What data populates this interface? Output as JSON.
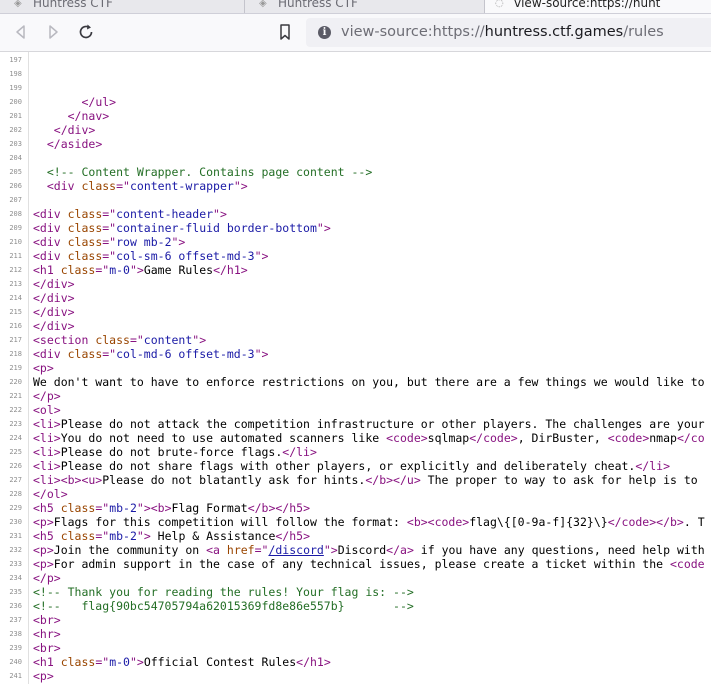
{
  "tabs": [
    {
      "title": "Huntress CTF",
      "active": false
    },
    {
      "title": "Huntress CTF",
      "active": false
    },
    {
      "title": "view-source:https://hunt",
      "active": true
    }
  ],
  "toolbar": {
    "back_icon": "arrow-left-icon",
    "forward_icon": "arrow-right-icon",
    "reload_icon": "reload-icon",
    "bookmark_icon": "bookmark-icon",
    "url_prefix": "view-source:https://",
    "url_host": "huntress.ctf.games",
    "url_path": "/rules"
  },
  "source_lines": [
    {
      "n": "197",
      "s": []
    },
    {
      "n": "198",
      "s": []
    },
    {
      "n": "199",
      "s": []
    },
    {
      "n": "200",
      "s": [
        {
          "t": "       "
        },
        {
          "c": "c-tag",
          "t": "</ul>"
        }
      ]
    },
    {
      "n": "201",
      "s": [
        {
          "t": "     "
        },
        {
          "c": "c-tag",
          "t": "</nav>"
        }
      ]
    },
    {
      "n": "202",
      "s": [
        {
          "t": "   "
        },
        {
          "c": "c-tag",
          "t": "</div>"
        }
      ]
    },
    {
      "n": "203",
      "s": [
        {
          "t": "  "
        },
        {
          "c": "c-tag",
          "t": "</aside>"
        }
      ]
    },
    {
      "n": "204",
      "s": []
    },
    {
      "n": "205",
      "s": [
        {
          "t": "  "
        },
        {
          "c": "c-cm",
          "t": "<!-- Content Wrapper. Contains page content -->"
        }
      ]
    },
    {
      "n": "206",
      "s": [
        {
          "t": "  "
        },
        {
          "c": "c-tag",
          "t": "<div "
        },
        {
          "c": "c-an",
          "t": "class"
        },
        {
          "c": "c-tag",
          "t": "=\""
        },
        {
          "c": "c-av",
          "t": "content-wrapper"
        },
        {
          "c": "c-tag",
          "t": "\">"
        }
      ]
    },
    {
      "n": "207",
      "s": []
    },
    {
      "n": "208",
      "s": [
        {
          "c": "c-tag",
          "t": "<div "
        },
        {
          "c": "c-an",
          "t": "class"
        },
        {
          "c": "c-tag",
          "t": "=\""
        },
        {
          "c": "c-av",
          "t": "content-header"
        },
        {
          "c": "c-tag",
          "t": "\">"
        }
      ]
    },
    {
      "n": "209",
      "s": [
        {
          "c": "c-tag",
          "t": "<div "
        },
        {
          "c": "c-an",
          "t": "class"
        },
        {
          "c": "c-tag",
          "t": "=\""
        },
        {
          "c": "c-av",
          "t": "container-fluid border-bottom"
        },
        {
          "c": "c-tag",
          "t": "\">"
        }
      ]
    },
    {
      "n": "210",
      "s": [
        {
          "c": "c-tag",
          "t": "<div "
        },
        {
          "c": "c-an",
          "t": "class"
        },
        {
          "c": "c-tag",
          "t": "=\""
        },
        {
          "c": "c-av",
          "t": "row mb-2"
        },
        {
          "c": "c-tag",
          "t": "\">"
        }
      ]
    },
    {
      "n": "211",
      "s": [
        {
          "c": "c-tag",
          "t": "<div "
        },
        {
          "c": "c-an",
          "t": "class"
        },
        {
          "c": "c-tag",
          "t": "=\""
        },
        {
          "c": "c-av",
          "t": "col-sm-6 offset-md-3"
        },
        {
          "c": "c-tag",
          "t": "\">"
        }
      ]
    },
    {
      "n": "212",
      "s": [
        {
          "c": "c-tag",
          "t": "<h1 "
        },
        {
          "c": "c-an",
          "t": "class"
        },
        {
          "c": "c-tag",
          "t": "=\""
        },
        {
          "c": "c-av",
          "t": "m-0"
        },
        {
          "c": "c-tag",
          "t": "\">"
        },
        {
          "t": "Game Rules"
        },
        {
          "c": "c-tag",
          "t": "</h1>"
        }
      ]
    },
    {
      "n": "213",
      "s": [
        {
          "c": "c-tag",
          "t": "</div>"
        }
      ]
    },
    {
      "n": "214",
      "s": [
        {
          "c": "c-tag",
          "t": "</div>"
        }
      ]
    },
    {
      "n": "215",
      "s": [
        {
          "c": "c-tag",
          "t": "</div>"
        }
      ]
    },
    {
      "n": "216",
      "s": [
        {
          "c": "c-tag",
          "t": "</div>"
        }
      ]
    },
    {
      "n": "217",
      "s": [
        {
          "c": "c-tag",
          "t": "<section "
        },
        {
          "c": "c-an",
          "t": "class"
        },
        {
          "c": "c-tag",
          "t": "=\""
        },
        {
          "c": "c-av",
          "t": "content"
        },
        {
          "c": "c-tag",
          "t": "\">"
        }
      ]
    },
    {
      "n": "218",
      "s": [
        {
          "c": "c-tag",
          "t": "<div "
        },
        {
          "c": "c-an",
          "t": "class"
        },
        {
          "c": "c-tag",
          "t": "=\""
        },
        {
          "c": "c-av",
          "t": "col-md-6 offset-md-3"
        },
        {
          "c": "c-tag",
          "t": "\">"
        }
      ]
    },
    {
      "n": "219",
      "s": [
        {
          "c": "c-tag",
          "t": "<p>"
        }
      ]
    },
    {
      "n": "220",
      "s": [
        {
          "t": "We don't want to have to enforce restrictions on you, but there are a few things we would like to"
        }
      ]
    },
    {
      "n": "221",
      "s": [
        {
          "c": "c-tag",
          "t": "</p>"
        }
      ]
    },
    {
      "n": "222",
      "s": [
        {
          "c": "c-tag",
          "t": "<ol>"
        }
      ]
    },
    {
      "n": "223",
      "s": [
        {
          "c": "c-tag",
          "t": "<li>"
        },
        {
          "t": "Please do not attack the competition infrastructure or other players. The challenges are your"
        }
      ]
    },
    {
      "n": "224",
      "s": [
        {
          "c": "c-tag",
          "t": "<li>"
        },
        {
          "t": "You do not need to use automated scanners like "
        },
        {
          "c": "c-tag",
          "t": "<code>"
        },
        {
          "t": "sqlmap"
        },
        {
          "c": "c-tag",
          "t": "</code>"
        },
        {
          "t": ", DirBuster, "
        },
        {
          "c": "c-tag",
          "t": "<code>"
        },
        {
          "t": "nmap"
        },
        {
          "c": "c-tag",
          "t": "</co"
        }
      ]
    },
    {
      "n": "225",
      "s": [
        {
          "c": "c-tag",
          "t": "<li>"
        },
        {
          "t": "Please do not brute-force flags."
        },
        {
          "c": "c-tag",
          "t": "</li>"
        }
      ]
    },
    {
      "n": "226",
      "s": [
        {
          "c": "c-tag",
          "t": "<li>"
        },
        {
          "t": "Please do not share flags with other players, or explicitly and deliberately cheat."
        },
        {
          "c": "c-tag",
          "t": "</li>"
        }
      ]
    },
    {
      "n": "227",
      "s": [
        {
          "c": "c-tag",
          "t": "<li><b><u>"
        },
        {
          "t": "Please do not blatantly ask for hints."
        },
        {
          "c": "c-tag",
          "t": "</b></u>"
        },
        {
          "t": " The proper to way to ask for help is to"
        }
      ]
    },
    {
      "n": "228",
      "s": [
        {
          "c": "c-tag",
          "t": "</ol>"
        }
      ]
    },
    {
      "n": "229",
      "s": [
        {
          "c": "c-tag",
          "t": "<h5 "
        },
        {
          "c": "c-an",
          "t": "class"
        },
        {
          "c": "c-tag",
          "t": "=\""
        },
        {
          "c": "c-av",
          "t": "mb-2"
        },
        {
          "c": "c-tag",
          "t": "\"><b>"
        },
        {
          "t": "Flag Format"
        },
        {
          "c": "c-tag",
          "t": "</b></h5>"
        }
      ]
    },
    {
      "n": "230",
      "s": [
        {
          "c": "c-tag",
          "t": "<p>"
        },
        {
          "t": "Flags for this competition will follow the format: "
        },
        {
          "c": "c-tag",
          "t": "<b><code>"
        },
        {
          "t": "flag\\{[0-9a-f]{32}\\}"
        },
        {
          "c": "c-tag",
          "t": "</code></b>"
        },
        {
          "t": ". T"
        }
      ]
    },
    {
      "n": "231",
      "s": [
        {
          "c": "c-tag",
          "t": "<h5 "
        },
        {
          "c": "c-an",
          "t": "class"
        },
        {
          "c": "c-tag",
          "t": "=\""
        },
        {
          "c": "c-av",
          "t": "mb-2"
        },
        {
          "c": "c-tag",
          "t": "\">"
        },
        {
          "t": " Help & Assistance"
        },
        {
          "c": "c-tag",
          "t": "</h5>"
        }
      ]
    },
    {
      "n": "232",
      "s": [
        {
          "c": "c-tag",
          "t": "<p>"
        },
        {
          "t": "Join the community on "
        },
        {
          "c": "c-tag",
          "t": "<a "
        },
        {
          "c": "c-an",
          "t": "href"
        },
        {
          "c": "c-tag",
          "t": "=\""
        },
        {
          "c": "c-lk",
          "t": "/discord"
        },
        {
          "c": "c-tag",
          "t": "\">"
        },
        {
          "t": "Discord"
        },
        {
          "c": "c-tag",
          "t": "</a>"
        },
        {
          "t": " if you have any questions, need help with"
        }
      ]
    },
    {
      "n": "233",
      "s": [
        {
          "c": "c-tag",
          "t": "<p>"
        },
        {
          "t": "For admin support in the case of any technical issues, please create a ticket within the "
        },
        {
          "c": "c-tag",
          "t": "<code"
        }
      ]
    },
    {
      "n": "234",
      "s": [
        {
          "c": "c-tag",
          "t": "</p>"
        }
      ]
    },
    {
      "n": "235",
      "s": [
        {
          "c": "c-cm",
          "t": "<!-- Thank you for reading the rules! Your flag is: -->"
        }
      ]
    },
    {
      "n": "236",
      "s": [
        {
          "c": "c-cm",
          "t": "<!--   flag{90bc54705794a62015369fd8e86e557b}       -->"
        }
      ]
    },
    {
      "n": "237",
      "s": [
        {
          "c": "c-tag",
          "t": "<br>"
        }
      ]
    },
    {
      "n": "238",
      "s": [
        {
          "c": "c-tag",
          "t": "<hr>"
        }
      ]
    },
    {
      "n": "239",
      "s": [
        {
          "c": "c-tag",
          "t": "<br>"
        }
      ]
    },
    {
      "n": "240",
      "s": [
        {
          "c": "c-tag",
          "t": "<h1 "
        },
        {
          "c": "c-an",
          "t": "class"
        },
        {
          "c": "c-tag",
          "t": "=\""
        },
        {
          "c": "c-av",
          "t": "m-0"
        },
        {
          "c": "c-tag",
          "t": "\">"
        },
        {
          "t": "Official Contest Rules"
        },
        {
          "c": "c-tag",
          "t": "</h1>"
        }
      ]
    },
    {
      "n": "241",
      "s": [
        {
          "c": "c-tag",
          "t": "<p>"
        }
      ]
    }
  ]
}
